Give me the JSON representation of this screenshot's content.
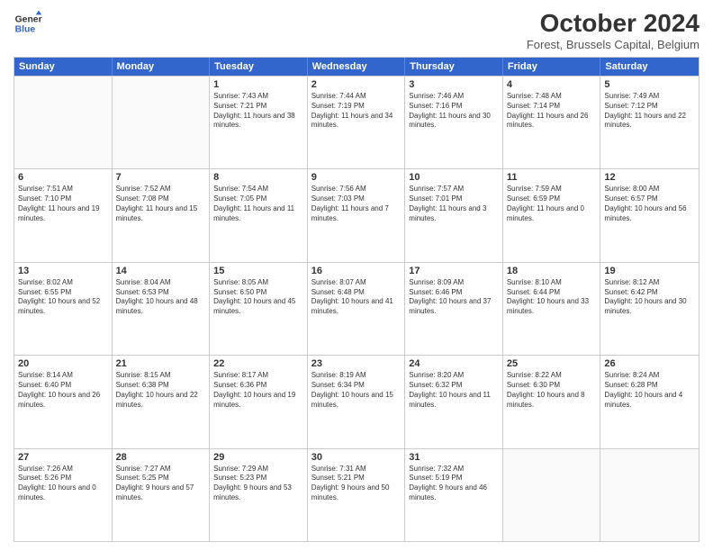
{
  "header": {
    "logo_line1": "General",
    "logo_line2": "Blue",
    "month": "October 2024",
    "location": "Forest, Brussels Capital, Belgium"
  },
  "days": [
    "Sunday",
    "Monday",
    "Tuesday",
    "Wednesday",
    "Thursday",
    "Friday",
    "Saturday"
  ],
  "rows": [
    [
      {
        "day": "",
        "empty": true
      },
      {
        "day": "",
        "empty": true
      },
      {
        "day": "1",
        "sunrise": "Sunrise: 7:43 AM",
        "sunset": "Sunset: 7:21 PM",
        "daylight": "Daylight: 11 hours and 38 minutes."
      },
      {
        "day": "2",
        "sunrise": "Sunrise: 7:44 AM",
        "sunset": "Sunset: 7:19 PM",
        "daylight": "Daylight: 11 hours and 34 minutes."
      },
      {
        "day": "3",
        "sunrise": "Sunrise: 7:46 AM",
        "sunset": "Sunset: 7:16 PM",
        "daylight": "Daylight: 11 hours and 30 minutes."
      },
      {
        "day": "4",
        "sunrise": "Sunrise: 7:48 AM",
        "sunset": "Sunset: 7:14 PM",
        "daylight": "Daylight: 11 hours and 26 minutes."
      },
      {
        "day": "5",
        "sunrise": "Sunrise: 7:49 AM",
        "sunset": "Sunset: 7:12 PM",
        "daylight": "Daylight: 11 hours and 22 minutes."
      }
    ],
    [
      {
        "day": "6",
        "sunrise": "Sunrise: 7:51 AM",
        "sunset": "Sunset: 7:10 PM",
        "daylight": "Daylight: 11 hours and 19 minutes."
      },
      {
        "day": "7",
        "sunrise": "Sunrise: 7:52 AM",
        "sunset": "Sunset: 7:08 PM",
        "daylight": "Daylight: 11 hours and 15 minutes."
      },
      {
        "day": "8",
        "sunrise": "Sunrise: 7:54 AM",
        "sunset": "Sunset: 7:05 PM",
        "daylight": "Daylight: 11 hours and 11 minutes."
      },
      {
        "day": "9",
        "sunrise": "Sunrise: 7:56 AM",
        "sunset": "Sunset: 7:03 PM",
        "daylight": "Daylight: 11 hours and 7 minutes."
      },
      {
        "day": "10",
        "sunrise": "Sunrise: 7:57 AM",
        "sunset": "Sunset: 7:01 PM",
        "daylight": "Daylight: 11 hours and 3 minutes."
      },
      {
        "day": "11",
        "sunrise": "Sunrise: 7:59 AM",
        "sunset": "Sunset: 6:59 PM",
        "daylight": "Daylight: 11 hours and 0 minutes."
      },
      {
        "day": "12",
        "sunrise": "Sunrise: 8:00 AM",
        "sunset": "Sunset: 6:57 PM",
        "daylight": "Daylight: 10 hours and 56 minutes."
      }
    ],
    [
      {
        "day": "13",
        "sunrise": "Sunrise: 8:02 AM",
        "sunset": "Sunset: 6:55 PM",
        "daylight": "Daylight: 10 hours and 52 minutes."
      },
      {
        "day": "14",
        "sunrise": "Sunrise: 8:04 AM",
        "sunset": "Sunset: 6:53 PM",
        "daylight": "Daylight: 10 hours and 48 minutes."
      },
      {
        "day": "15",
        "sunrise": "Sunrise: 8:05 AM",
        "sunset": "Sunset: 6:50 PM",
        "daylight": "Daylight: 10 hours and 45 minutes."
      },
      {
        "day": "16",
        "sunrise": "Sunrise: 8:07 AM",
        "sunset": "Sunset: 6:48 PM",
        "daylight": "Daylight: 10 hours and 41 minutes."
      },
      {
        "day": "17",
        "sunrise": "Sunrise: 8:09 AM",
        "sunset": "Sunset: 6:46 PM",
        "daylight": "Daylight: 10 hours and 37 minutes."
      },
      {
        "day": "18",
        "sunrise": "Sunrise: 8:10 AM",
        "sunset": "Sunset: 6:44 PM",
        "daylight": "Daylight: 10 hours and 33 minutes."
      },
      {
        "day": "19",
        "sunrise": "Sunrise: 8:12 AM",
        "sunset": "Sunset: 6:42 PM",
        "daylight": "Daylight: 10 hours and 30 minutes."
      }
    ],
    [
      {
        "day": "20",
        "sunrise": "Sunrise: 8:14 AM",
        "sunset": "Sunset: 6:40 PM",
        "daylight": "Daylight: 10 hours and 26 minutes."
      },
      {
        "day": "21",
        "sunrise": "Sunrise: 8:15 AM",
        "sunset": "Sunset: 6:38 PM",
        "daylight": "Daylight: 10 hours and 22 minutes."
      },
      {
        "day": "22",
        "sunrise": "Sunrise: 8:17 AM",
        "sunset": "Sunset: 6:36 PM",
        "daylight": "Daylight: 10 hours and 19 minutes."
      },
      {
        "day": "23",
        "sunrise": "Sunrise: 8:19 AM",
        "sunset": "Sunset: 6:34 PM",
        "daylight": "Daylight: 10 hours and 15 minutes."
      },
      {
        "day": "24",
        "sunrise": "Sunrise: 8:20 AM",
        "sunset": "Sunset: 6:32 PM",
        "daylight": "Daylight: 10 hours and 11 minutes."
      },
      {
        "day": "25",
        "sunrise": "Sunrise: 8:22 AM",
        "sunset": "Sunset: 6:30 PM",
        "daylight": "Daylight: 10 hours and 8 minutes."
      },
      {
        "day": "26",
        "sunrise": "Sunrise: 8:24 AM",
        "sunset": "Sunset: 6:28 PM",
        "daylight": "Daylight: 10 hours and 4 minutes."
      }
    ],
    [
      {
        "day": "27",
        "sunrise": "Sunrise: 7:26 AM",
        "sunset": "Sunset: 5:26 PM",
        "daylight": "Daylight: 10 hours and 0 minutes."
      },
      {
        "day": "28",
        "sunrise": "Sunrise: 7:27 AM",
        "sunset": "Sunset: 5:25 PM",
        "daylight": "Daylight: 9 hours and 57 minutes."
      },
      {
        "day": "29",
        "sunrise": "Sunrise: 7:29 AM",
        "sunset": "Sunset: 5:23 PM",
        "daylight": "Daylight: 9 hours and 53 minutes."
      },
      {
        "day": "30",
        "sunrise": "Sunrise: 7:31 AM",
        "sunset": "Sunset: 5:21 PM",
        "daylight": "Daylight: 9 hours and 50 minutes."
      },
      {
        "day": "31",
        "sunrise": "Sunrise: 7:32 AM",
        "sunset": "Sunset: 5:19 PM",
        "daylight": "Daylight: 9 hours and 46 minutes."
      },
      {
        "day": "",
        "empty": true
      },
      {
        "day": "",
        "empty": true
      }
    ]
  ]
}
